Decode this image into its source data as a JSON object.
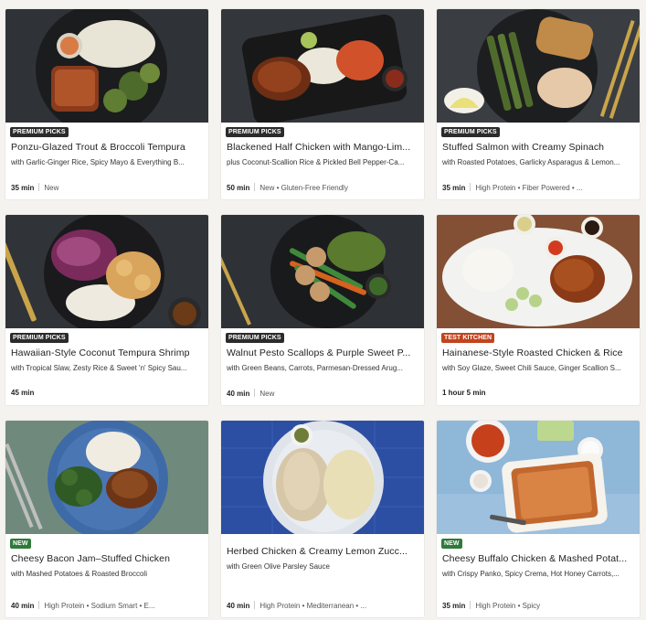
{
  "recipes": [
    {
      "badge": "PREMIUM PICKS",
      "badge_type": "premium",
      "title": "Ponzu-Glazed Trout & Broccoli Tempura",
      "subtitle": "with Garlic-Ginger Rice, Spicy Mayo & Everything B...",
      "time": "35 min",
      "tags": "New",
      "image": {
        "bg": "#2f3338",
        "plate": "#1b1c1e",
        "icon": "plate-dish-icon"
      }
    },
    {
      "badge": "PREMIUM PICKS",
      "badge_type": "premium",
      "title": "Blackened Half Chicken with Mango-Lim...",
      "subtitle": "plus Coconut-Scallion Rice & Pickled Bell Pepper-Ca...",
      "time": "50 min",
      "tags": "New • Gluten-Free Friendly",
      "image": {
        "bg": "#33363b",
        "plate": "#181818",
        "icon": "plate-dish-icon"
      }
    },
    {
      "badge": "PREMIUM PICKS",
      "badge_type": "premium",
      "title": "Stuffed Salmon with Creamy Spinach",
      "subtitle": "with Roasted Potatoes, Garlicky Asparagus & Lemon...",
      "time": "35 min",
      "tags": "High Protein • Fiber Powered • ...",
      "image": {
        "bg": "#3a3d42",
        "plate": "#1d1e20",
        "icon": "plate-dish-icon"
      }
    },
    {
      "badge": "PREMIUM PICKS",
      "badge_type": "premium",
      "title": "Hawaiian-Style Coconut Tempura Shrimp",
      "subtitle": "with Tropical Slaw, Zesty Rice & Sweet 'n' Spicy Sau...",
      "time": "45 min",
      "tags": "",
      "image": {
        "bg": "#303338",
        "plate": "#1a1a1c",
        "icon": "plate-dish-icon"
      }
    },
    {
      "badge": "PREMIUM PICKS",
      "badge_type": "premium",
      "title": "Walnut Pesto Scallops & Purple Sweet P...",
      "subtitle": "with Green Beans, Carrots, Parmesan-Dressed Arug...",
      "time": "40 min",
      "tags": "New",
      "image": {
        "bg": "#2e3136",
        "plate": "#191a1c",
        "icon": "plate-dish-icon"
      }
    },
    {
      "badge": "TEST KITCHEN",
      "badge_type": "test",
      "title": "Hainanese-Style Roasted Chicken & Rice",
      "subtitle": "with Soy Glaze, Sweet Chili Sauce, Ginger Scallion S...",
      "time": "1 hour 5 min",
      "tags": "",
      "image": {
        "bg": "#7a4a32",
        "plate": "#f2f2f0",
        "icon": "plate-dish-icon"
      }
    },
    {
      "badge": "NEW",
      "badge_type": "new",
      "title": "Cheesy Bacon Jam–Stuffed Chicken",
      "subtitle": "with Mashed Potatoes & Roasted Broccoli",
      "time": "40 min",
      "tags": "High Protein • Sodium Smart • E...",
      "image": {
        "bg": "#5d7a6b",
        "plate": "#3f6aa8",
        "icon": "plate-dish-icon"
      }
    },
    {
      "badge": "",
      "badge_type": "none",
      "title": "Herbed Chicken & Creamy Lemon Zucc...",
      "subtitle": "with Green Olive Parsley Sauce",
      "time": "40 min",
      "tags": "High Protein • Mediterranean • ...",
      "image": {
        "bg": "#2c4fa3",
        "plate": "#dfe3ea",
        "icon": "plate-dish-icon"
      }
    },
    {
      "badge": "NEW",
      "badge_type": "new",
      "title": "Cheesy Buffalo Chicken & Mashed Potat...",
      "subtitle": "with Crispy Panko, Spicy Crema, Hot Honey Carrots,...",
      "time": "35 min",
      "tags": "High Protein • Spicy",
      "image": {
        "bg": "#8fb7d8",
        "plate": "#f3f3f3",
        "icon": "baking-dish-icon"
      }
    }
  ]
}
